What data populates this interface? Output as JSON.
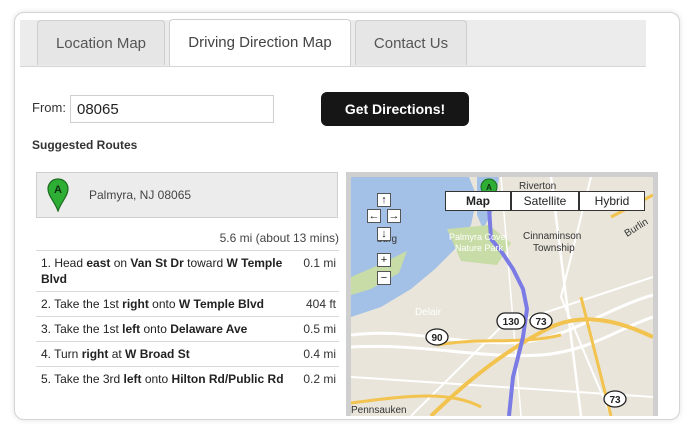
{
  "tabs": [
    {
      "label": "Location Map",
      "active": false
    },
    {
      "label": "Driving Direction Map",
      "active": true
    },
    {
      "label": "Contact Us",
      "active": false
    }
  ],
  "form": {
    "from_label": "From:",
    "from_value": "08065",
    "button_label": "Get Directions!"
  },
  "routes": {
    "heading": "Suggested Routes",
    "destination": "Palmyra, NJ 08065",
    "marker_letter": "A",
    "summary": "5.6 mi (about 13 mins)"
  },
  "map": {
    "types": [
      "Map",
      "Satellite",
      "Hybrid"
    ],
    "selected_type": "Map",
    "labels": {
      "riverton": "Riverton",
      "burg": "burg",
      "palmyra_cove": "Palmyra Cove",
      "nature_park": "Nature Park",
      "cinnaminson": "Cinnaminson",
      "township": "Township",
      "delair": "Delair",
      "pennsauken": "Pennsauken",
      "burlington": "Burlin"
    },
    "shields": {
      "h130": "130",
      "h73a": "73",
      "h90": "90",
      "h73b": "73"
    }
  },
  "colors": {
    "route": "#7b7be6",
    "water": "#a3c0e6",
    "land": "#e9e5da",
    "park": "#c7dca6",
    "highway": "#f2c34e"
  }
}
